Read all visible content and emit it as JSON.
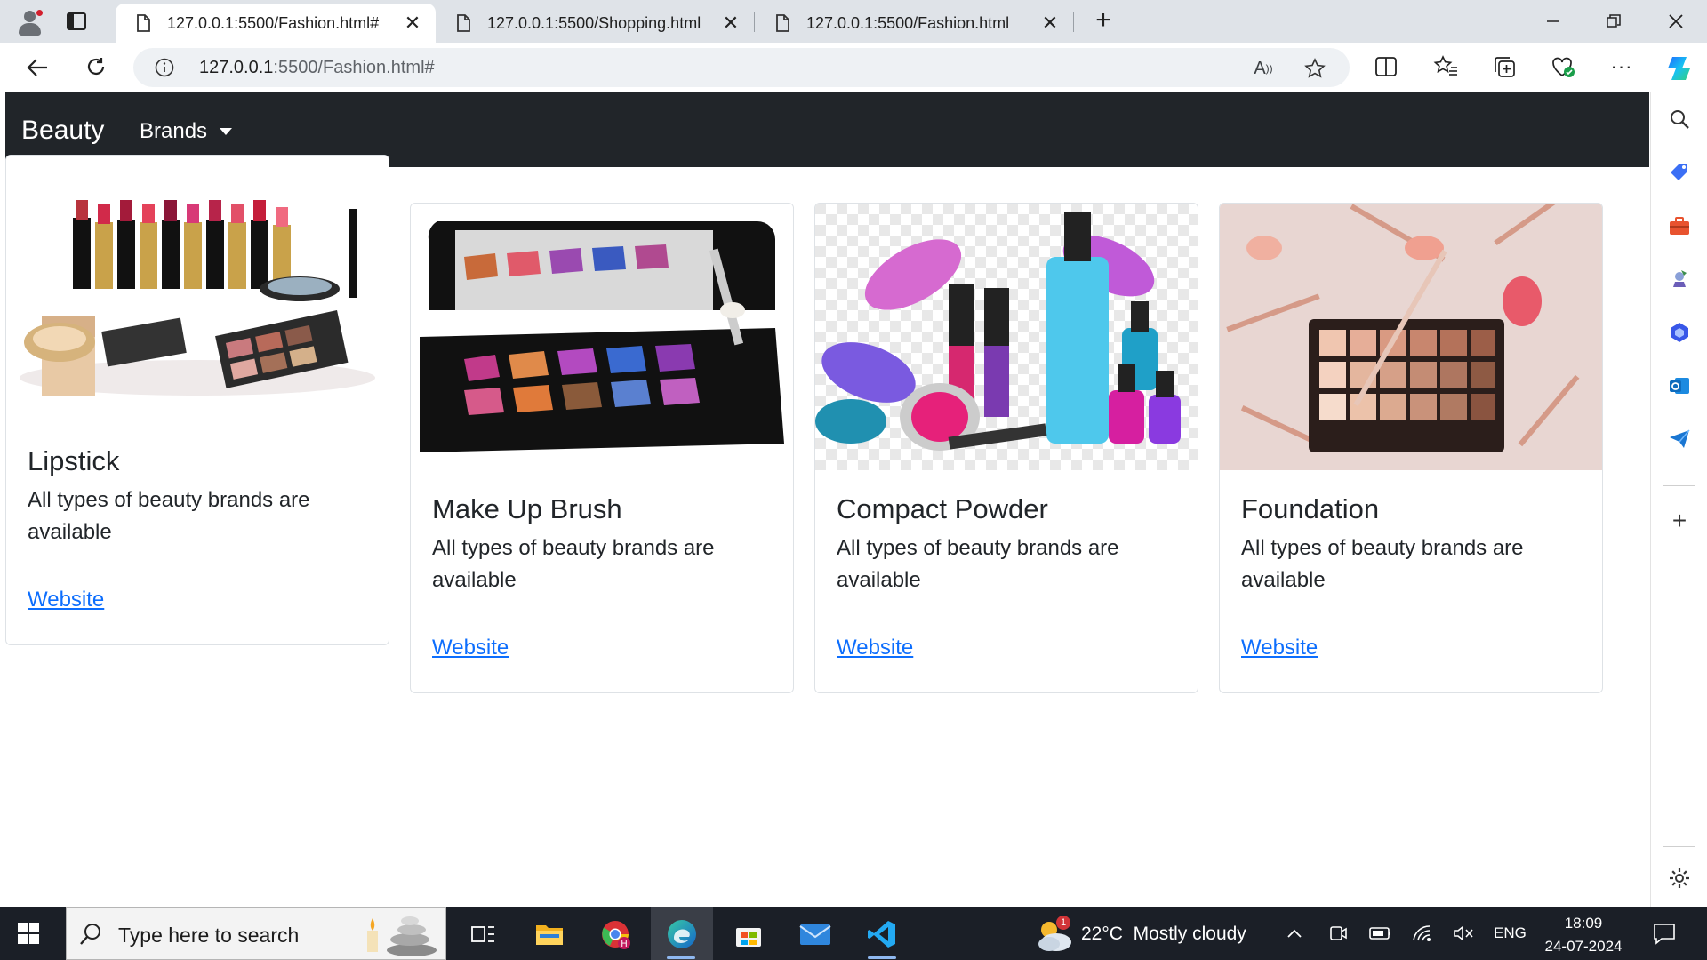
{
  "browser": {
    "tabs": [
      {
        "title": "127.0.0.1:5500/Fashion.html#",
        "active": true
      },
      {
        "title": "127.0.0.1:5500/Shopping.html",
        "active": false
      },
      {
        "title": "127.0.0.1:5500/Fashion.html",
        "active": false
      }
    ],
    "new_tab_icon": "plus-icon",
    "address": {
      "host": "127.0.0.1",
      "rest": ":5500/Fashion.html#"
    }
  },
  "page": {
    "brand": "Beauty",
    "nav_dropdown": "Brands",
    "cards": [
      {
        "title": "Lipstick",
        "text": "All types of beauty brands are available",
        "link": "Website"
      },
      {
        "title": "Make Up Brush",
        "text": "All types of beauty brands are available",
        "link": "Website"
      },
      {
        "title": "Compact Powder",
        "text": "All types of beauty brands are available",
        "link": "Website"
      },
      {
        "title": "Foundation",
        "text": "All types of beauty brands are available",
        "link": "Website"
      }
    ]
  },
  "taskbar": {
    "search_placeholder": "Type here to search",
    "weather": {
      "temp": "22°C",
      "condition": "Mostly cloudy",
      "badge": "1"
    },
    "language": "ENG",
    "time": "18:09",
    "date": "24-07-2024"
  },
  "colors": {
    "navbar_bg": "#212529",
    "link": "#0d6efd",
    "taskbar_bg": "#1b1f27",
    "tabstrip_bg": "#dfe3e8"
  }
}
